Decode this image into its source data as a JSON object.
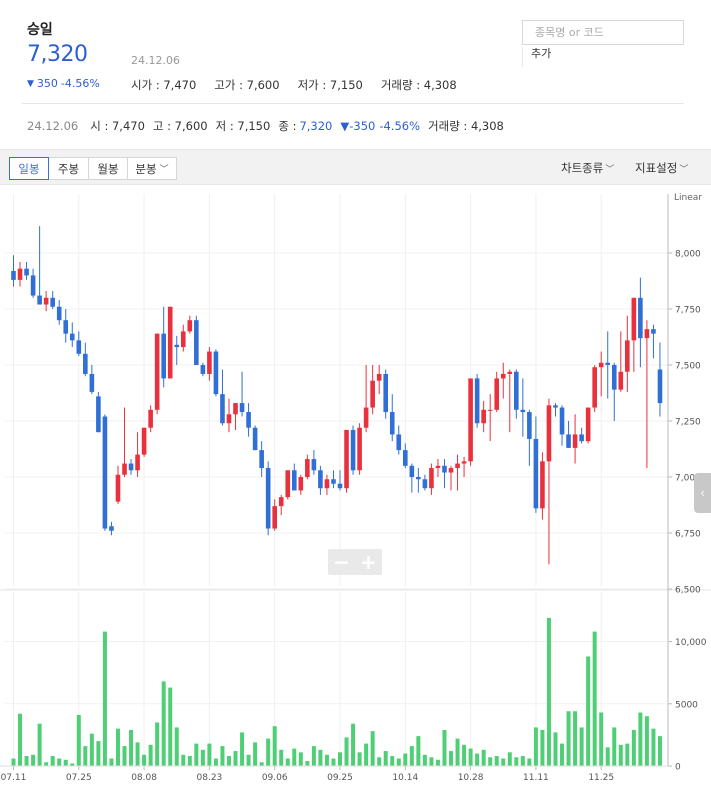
{
  "header": {
    "name": "승일",
    "price": "7,320",
    "date": "24.12.06",
    "change": "350",
    "change_pct": "-4.56%",
    "open": "시가 : 7,470",
    "high": "고가 : 7,600",
    "low": "저가 : 7,150",
    "volume": "거래량 : 4,308"
  },
  "search": {
    "placeholder": "종목명 or 코드",
    "add_label": "추가"
  },
  "info_line": {
    "date": "24.12.06",
    "open": "시 : 7,470",
    "high": "고 : 7,600",
    "low": "저 : 7,150",
    "close_label": "종 :",
    "close": "7,320",
    "change": "▼-350",
    "change_pct": "-4.56%",
    "volume": "거래량 : 4,308"
  },
  "toolbar": {
    "tabs": [
      "일봉",
      "주봉",
      "월봉",
      "분봉"
    ],
    "active_tab": "일봉",
    "chart_type": "차트종류",
    "indicator": "지표설정"
  },
  "colors": {
    "up": "#e8313d",
    "down": "#2f6fd6",
    "volume": "#4fcf75",
    "price_text": "#2d5fd0"
  },
  "chart_data": {
    "type": "candlestick",
    "price_scale": "Linear",
    "price_ticks": [
      "8,000",
      "7,750",
      "7,500",
      "7,250",
      "7,000",
      "6,750",
      "6,500"
    ],
    "price_range": [
      6500,
      8250
    ],
    "volume_ticks": [
      "10,000",
      "5000",
      "0"
    ],
    "volume_range": [
      0,
      13500
    ],
    "x_labels": [
      "07.11",
      "07.25",
      "08.08",
      "08.23",
      "09.06",
      "09.25",
      "10.14",
      "10.28",
      "11.11",
      "11.25"
    ],
    "x_label_index": [
      0,
      10,
      20,
      30,
      40,
      50,
      60,
      70,
      80,
      90
    ],
    "candles": [
      [
        7920,
        7990,
        7850,
        7880
      ],
      [
        7880,
        7960,
        7850,
        7930
      ],
      [
        7930,
        7960,
        7880,
        7900
      ],
      [
        7900,
        7930,
        7800,
        7810
      ],
      [
        7810,
        8120,
        7770,
        7770
      ],
      [
        7770,
        7830,
        7740,
        7800
      ],
      [
        7800,
        7830,
        7750,
        7760
      ],
      [
        7760,
        7790,
        7680,
        7700
      ],
      [
        7700,
        7750,
        7600,
        7640
      ],
      [
        7640,
        7690,
        7580,
        7610
      ],
      [
        7610,
        7650,
        7540,
        7550
      ],
      [
        7550,
        7600,
        7450,
        7460
      ],
      [
        7460,
        7500,
        7370,
        7380
      ],
      [
        7360,
        7380,
        7200,
        7200
      ],
      [
        7270,
        7280,
        6760,
        6770
      ],
      [
        6780,
        6800,
        6740,
        6760
      ],
      [
        6890,
        7050,
        6880,
        7010
      ],
      [
        7010,
        7310,
        7000,
        7060
      ],
      [
        7060,
        7080,
        7010,
        7030
      ],
      [
        7030,
        7200,
        7000,
        7100
      ],
      [
        7100,
        7220,
        7090,
        7220
      ],
      [
        7220,
        7320,
        7200,
        7300
      ],
      [
        7300,
        7640,
        7280,
        7640
      ],
      [
        7640,
        7760,
        7400,
        7440
      ],
      [
        7440,
        7760,
        7580,
        7760
      ],
      [
        7590,
        7630,
        7500,
        7580
      ],
      [
        7580,
        7680,
        7560,
        7650
      ],
      [
        7650,
        7720,
        7640,
        7700
      ],
      [
        7700,
        7720,
        7500,
        7500
      ],
      [
        7500,
        7510,
        7450,
        7460
      ],
      [
        7460,
        7580,
        7430,
        7560
      ],
      [
        7560,
        7570,
        7360,
        7370
      ],
      [
        7370,
        7480,
        7230,
        7240
      ],
      [
        7240,
        7350,
        7200,
        7280
      ],
      [
        7280,
        7330,
        7210,
        7330
      ],
      [
        7330,
        7470,
        7270,
        7290
      ],
      [
        7290,
        7330,
        7180,
        7220
      ],
      [
        7220,
        7230,
        7120,
        7120
      ],
      [
        7120,
        7160,
        7000,
        7040
      ],
      [
        7040,
        7070,
        6740,
        6770
      ],
      [
        6770,
        6900,
        6760,
        6870
      ],
      [
        6870,
        6920,
        6830,
        6910
      ],
      [
        6910,
        7030,
        6900,
        7030
      ],
      [
        7030,
        7060,
        6940,
        6940
      ],
      [
        6940,
        7010,
        6920,
        7000
      ],
      [
        7000,
        7100,
        6990,
        7080
      ],
      [
        7080,
        7120,
        7010,
        7030
      ],
      [
        7030,
        7050,
        6920,
        6950
      ],
      [
        6950,
        7010,
        6920,
        6990
      ],
      [
        6990,
        7030,
        6950,
        6970
      ],
      [
        6970,
        7030,
        6940,
        6950
      ],
      [
        6950,
        7210,
        6930,
        7210
      ],
      [
        7210,
        7230,
        7010,
        7030
      ],
      [
        7030,
        7240,
        7010,
        7220
      ],
      [
        7220,
        7500,
        7200,
        7310
      ],
      [
        7310,
        7500,
        7280,
        7430
      ],
      [
        7430,
        7500,
        7370,
        7460
      ],
      [
        7460,
        7480,
        7260,
        7290
      ],
      [
        7290,
        7370,
        7160,
        7190
      ],
      [
        7190,
        7230,
        7100,
        7120
      ],
      [
        7120,
        7150,
        7040,
        7050
      ],
      [
        7050,
        7060,
        6930,
        7000
      ],
      [
        7000,
        7040,
        6930,
        6990
      ],
      [
        6990,
        7010,
        6940,
        6950
      ],
      [
        6950,
        7060,
        6920,
        7040
      ],
      [
        7040,
        7080,
        7000,
        7050
      ],
      [
        7050,
        7080,
        6950,
        7020
      ],
      [
        7020,
        7050,
        6940,
        7040
      ],
      [
        7040,
        7100,
        6940,
        7060
      ],
      [
        7060,
        7090,
        7000,
        7070
      ],
      [
        7070,
        7440,
        7050,
        7440
      ],
      [
        7440,
        7460,
        7220,
        7240
      ],
      [
        7240,
        7340,
        7200,
        7300
      ],
      [
        7300,
        7370,
        7160,
        7300
      ],
      [
        7300,
        7470,
        7290,
        7440
      ],
      [
        7440,
        7510,
        7350,
        7460
      ],
      [
        7460,
        7480,
        7200,
        7470
      ],
      [
        7470,
        7480,
        7260,
        7300
      ],
      [
        7300,
        7440,
        7180,
        7290
      ],
      [
        7290,
        7300,
        7050,
        7170
      ],
      [
        7170,
        7270,
        6840,
        6860
      ],
      [
        6860,
        7110,
        6810,
        7070
      ],
      [
        7070,
        7350,
        6610,
        7320
      ],
      [
        7320,
        7330,
        7270,
        7310
      ],
      [
        7310,
        7320,
        7140,
        7190
      ],
      [
        7190,
        7250,
        7130,
        7130
      ],
      [
        7130,
        7280,
        7060,
        7190
      ],
      [
        7190,
        7220,
        7150,
        7160
      ],
      [
        7160,
        7310,
        7150,
        7310
      ],
      [
        7310,
        7500,
        7290,
        7490
      ],
      [
        7490,
        7560,
        7360,
        7510
      ],
      [
        7510,
        7650,
        7350,
        7500
      ],
      [
        7500,
        7510,
        7250,
        7390
      ],
      [
        7390,
        7650,
        7380,
        7470
      ],
      [
        7470,
        7720,
        7380,
        7610
      ],
      [
        7610,
        7800,
        7470,
        7800
      ],
      [
        7800,
        7890,
        7490,
        7620
      ],
      [
        7620,
        7700,
        7040,
        7660
      ],
      [
        7660,
        7680,
        7530,
        7640
      ],
      [
        7480,
        7600,
        7270,
        7330
      ]
    ],
    "volumes": [
      600,
      4200,
      800,
      900,
      3400,
      300,
      800,
      600,
      500,
      200,
      4100,
      1600,
      2600,
      2000,
      10800,
      600,
      3000,
      1600,
      2900,
      1900,
      900,
      1700,
      3500,
      6800,
      6300,
      3100,
      900,
      800,
      1800,
      1300,
      1800,
      600,
      1600,
      800,
      1200,
      2700,
      900,
      1900,
      300,
      2200,
      3200,
      1300,
      600,
      1400,
      1100,
      400,
      1600,
      1300,
      900,
      600,
      1100,
      2300,
      3400,
      1100,
      1800,
      2800,
      700,
      1200,
      800,
      600,
      1000,
      1600,
      2400,
      900,
      700,
      500,
      2900,
      1200,
      2200,
      1700,
      1400,
      1000,
      1300,
      700,
      800,
      600,
      1100,
      700,
      800,
      600,
      3100,
      2900,
      11900,
      2700,
      1800,
      4400,
      4400,
      3100,
      8800,
      10800,
      4300,
      1500,
      3100,
      1700,
      1800,
      2900,
      4300,
      4000,
      3000,
      2400
    ]
  },
  "zoom": {
    "minus": "−",
    "plus": "+"
  }
}
